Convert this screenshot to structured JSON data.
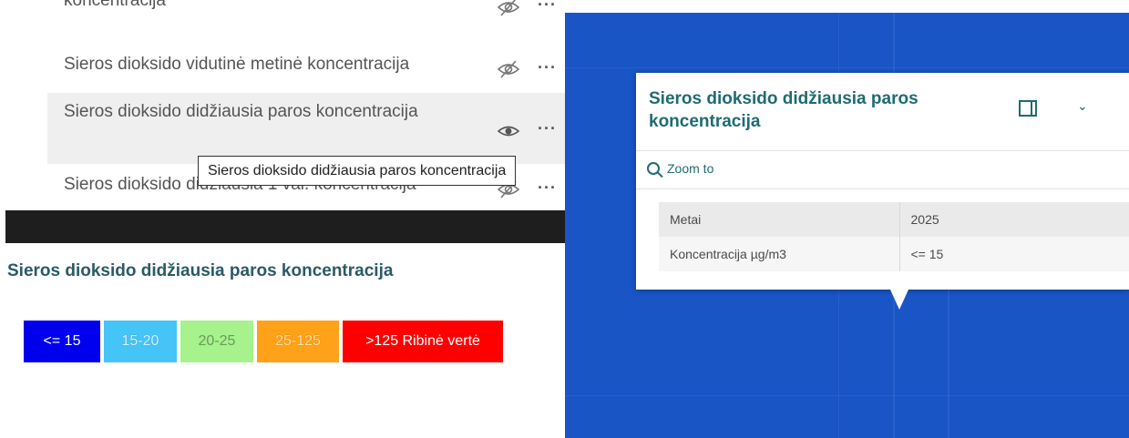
{
  "layers": {
    "items": [
      {
        "label": "koncentracija",
        "visible": false,
        "visibility_icon": "eye-off-icon",
        "more": "···"
      },
      {
        "label": "Sieros dioksido vidutinė metinė koncentracija",
        "visible": false,
        "visibility_icon": "eye-off-icon",
        "more": "···"
      },
      {
        "label": "Sieros dioksido didžiausia paros koncentracija",
        "visible": true,
        "visibility_icon": "eye-icon",
        "more": "···"
      },
      {
        "label": "Sieros dioksido didžiausia 1 val. koncentracija",
        "visible": false,
        "visibility_icon": "eye-off-icon",
        "more": "···"
      }
    ],
    "tooltip": "Sieros dioksido didžiausia paros koncentracija"
  },
  "legend": {
    "title": "Sieros dioksido didžiausia paros koncentracija",
    "classes": [
      {
        "label": "<= 15",
        "color": "#0000ee"
      },
      {
        "label": "15-20",
        "color": "#45c4f7"
      },
      {
        "label": "20-25",
        "color": "#a6f28c"
      },
      {
        "label": "25-125",
        "color": "#ffa21a"
      },
      {
        "label": ">125 Ribinė vertė",
        "color": "#ff0000"
      }
    ]
  },
  "popup": {
    "title": "Sieros dioksido didžiausia paros koncentracija",
    "zoom_label": "Zoom to",
    "rows": [
      {
        "key": "Metai",
        "value": "2025"
      },
      {
        "key": "Koncentracija µg/m3",
        "value": "<= 15"
      }
    ]
  },
  "colors": {
    "accent": "#1f6b72",
    "map": "#1a55c6"
  }
}
